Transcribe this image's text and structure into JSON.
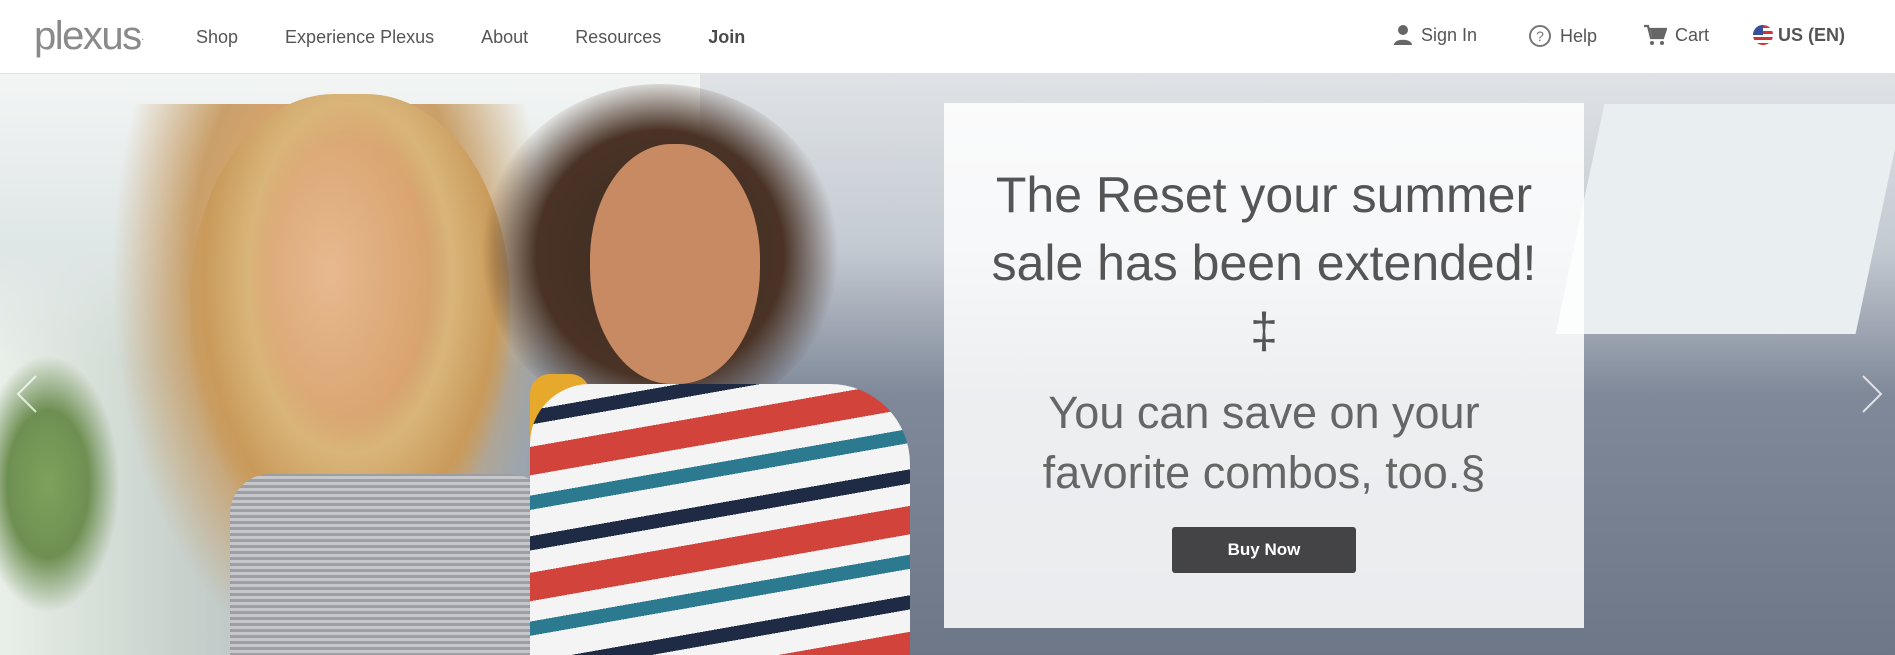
{
  "header": {
    "logo_text": "plexus",
    "nav": [
      {
        "label": "Shop"
      },
      {
        "label": "Experience Plexus"
      },
      {
        "label": "About"
      },
      {
        "label": "Resources"
      },
      {
        "label": "Join"
      }
    ],
    "utility": {
      "sign_in": "Sign In",
      "help": "Help",
      "cart": "Cart",
      "locale": "US (EN)"
    }
  },
  "hero": {
    "headline_line1": "The Reset your summer",
    "headline_line2": "sale has been extended!",
    "headline_mark": "‡",
    "subline_line1": "You can save on your",
    "subline_line2": "favorite combos, too.§",
    "cta_label": "Buy Now"
  },
  "colors": {
    "cta_background": "#444345",
    "text": "#555555"
  },
  "icons": [
    "person-icon",
    "help-circle-icon",
    "cart-icon",
    "us-flag-icon",
    "chevron-left-icon",
    "chevron-right-icon"
  ]
}
